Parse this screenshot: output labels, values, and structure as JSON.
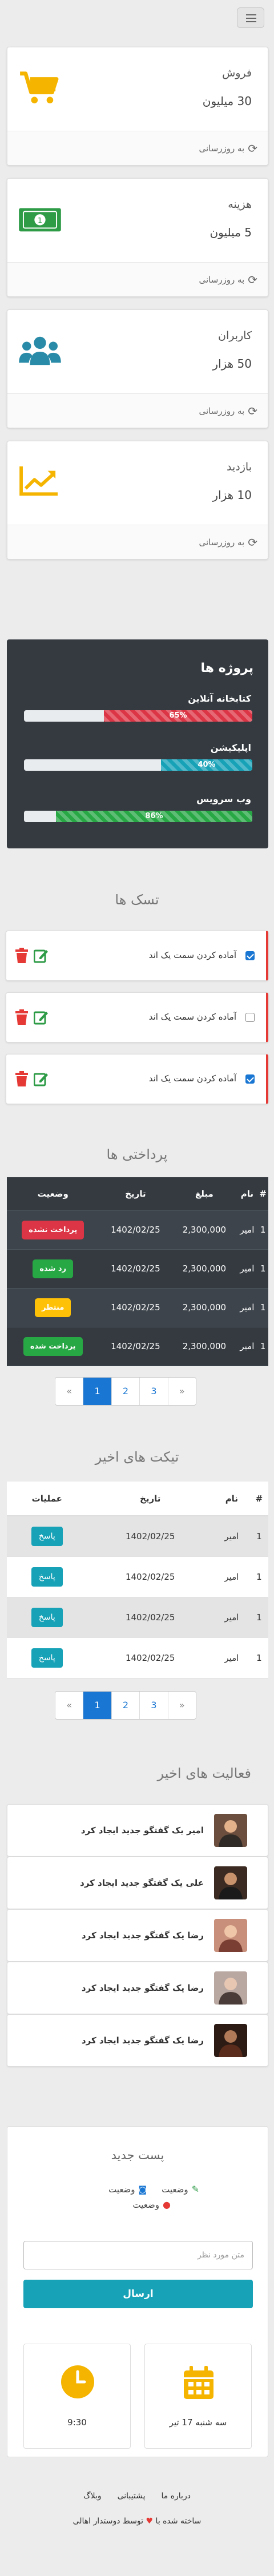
{
  "stats": [
    {
      "title": "فروش",
      "value": "30 میلیون",
      "refresh": "به روزرسانی",
      "icon": "cart-icon",
      "color": "#f4b400"
    },
    {
      "title": "هزینه",
      "value": "5 میلیون",
      "refresh": "به روزرسانی",
      "icon": "money-icon",
      "color": "#2e9b47"
    },
    {
      "title": "کاربران",
      "value": "50 هزار",
      "refresh": "به روزرسانی",
      "icon": "users-icon",
      "color": "#2a8ba8"
    },
    {
      "title": "بازدید",
      "value": "10 هزار",
      "refresh": "به روزرسانی",
      "icon": "chart-up-icon",
      "color": "#f4b400"
    }
  ],
  "projects": {
    "title": "پروژه ها",
    "items": [
      {
        "name": "کتابخانه آنلاین",
        "percent": 65,
        "label": "65%",
        "color": "#dc3545"
      },
      {
        "name": "اپلیکیشن",
        "percent": 40,
        "label": "40%",
        "color": "#17a2b8"
      },
      {
        "name": "وب سرویس",
        "percent": 86,
        "label": "86%",
        "color": "#28a745"
      }
    ]
  },
  "tasks": {
    "title": "تسک ها",
    "items": [
      {
        "text": "آماده کردن سمت یک اند",
        "checked": true
      },
      {
        "text": "آماده کردن سمت یک اند",
        "checked": false
      },
      {
        "text": "آماده کردن سمت یک اند",
        "checked": true
      }
    ]
  },
  "payments": {
    "title": "پرداختی ها",
    "headers": [
      "#",
      "نام",
      "مبلغ",
      "تاریخ",
      "وضعیت"
    ],
    "rows": [
      {
        "id": "1",
        "name": "امیر",
        "amount": "2,300,000",
        "date": "1402/02/25",
        "status": "پرداخت نشده",
        "status_color": "#dc3545"
      },
      {
        "id": "1",
        "name": "امیر",
        "amount": "2,300,000",
        "date": "1402/02/25",
        "status": "رد شده",
        "status_color": "#28a745"
      },
      {
        "id": "1",
        "name": "امیر",
        "amount": "2,300,000",
        "date": "1402/02/25",
        "status": "منتظر",
        "status_color": "#ffc107"
      },
      {
        "id": "1",
        "name": "امیر",
        "amount": "2,300,000",
        "date": "1402/02/25",
        "status": "پرداخت شده",
        "status_color": "#28a745"
      }
    ]
  },
  "pagination": {
    "prev": "«",
    "pages": [
      "1",
      "2",
      "3"
    ],
    "next": "»"
  },
  "tickets": {
    "title": "تیکت های اخیر",
    "headers": [
      "#",
      "نام",
      "تاریخ",
      "عملیات"
    ],
    "rows": [
      {
        "id": "1",
        "name": "امیر",
        "date": "1402/02/25",
        "action": "پاسخ"
      },
      {
        "id": "1",
        "name": "امیر",
        "date": "1402/02/25",
        "action": "پاسخ"
      },
      {
        "id": "1",
        "name": "امیر",
        "date": "1402/02/25",
        "action": "پاسخ"
      },
      {
        "id": "1",
        "name": "امیر",
        "date": "1402/02/25",
        "action": "پاسخ"
      }
    ]
  },
  "activities": {
    "title": "فعالیت های اخیر",
    "items": [
      {
        "text": "امیر یک گفتگو جدید ایجاد کرد"
      },
      {
        "text": "علی یک گفتگو جدید ایجاد کرد"
      },
      {
        "text": "رضا یک گفتگو جدید ایجاد کرد"
      },
      {
        "text": "رضا یک گفتگو جدید ایجاد کرد"
      },
      {
        "text": "رضا یک گفتگو جدید ایجاد کرد"
      }
    ]
  },
  "new_post": {
    "title": "پست جدید",
    "tool_status_1": "وضعیت",
    "tool_status_2": "وضعیت",
    "tool_status_3": "وضعیت",
    "placeholder": "متن مورد نظر",
    "send": "ارسال"
  },
  "widgets": {
    "date": "سه شنبه 17 تیر",
    "time": "9:30"
  },
  "footer": {
    "links": [
      "درباره ما",
      "پشتیبانی",
      "وبلاگ"
    ],
    "credit_before": "ساخته شده با",
    "credit_after": "توسط دوستدار اهالی"
  }
}
